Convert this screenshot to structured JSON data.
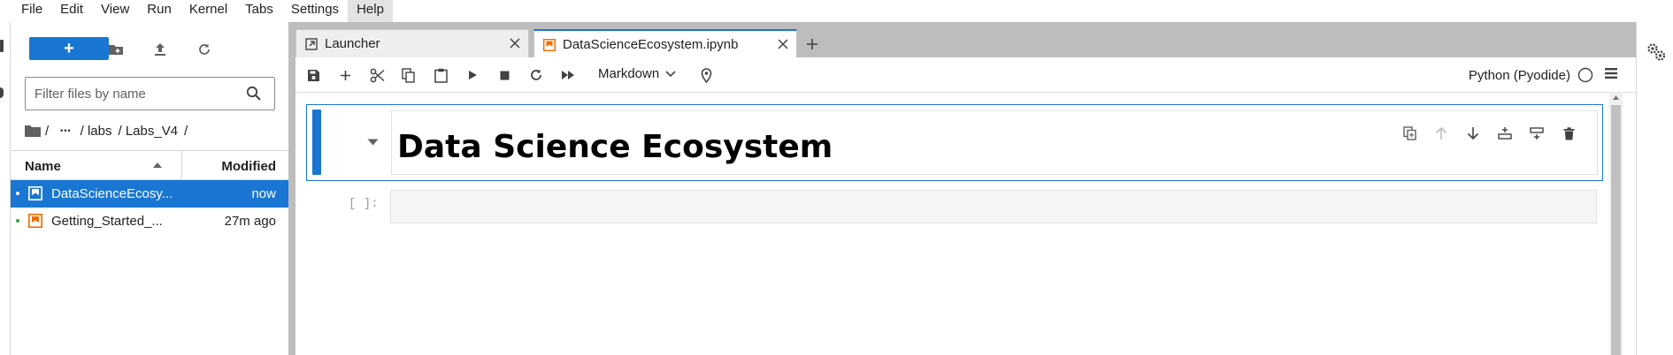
{
  "menubar": {
    "items": [
      "File",
      "Edit",
      "View",
      "Run",
      "Kernel",
      "Tabs",
      "Settings",
      "Help"
    ],
    "active": "Help"
  },
  "filebrowser": {
    "new_button": "+",
    "filter_placeholder": "Filter files by name",
    "breadcrumbs": [
      "/",
      "•••",
      "/ labs",
      "/ Labs_V4",
      "/"
    ],
    "columns": {
      "name": "Name",
      "modified": "Modified"
    },
    "files": [
      {
        "name": "DataScienceEcosystem.ipynb",
        "display": "DataScienceEcosy...",
        "modified": "now",
        "selected": true
      },
      {
        "name": "Getting_Started_with_Jupyter.ipynb",
        "display": "Getting_Started_...",
        "modified": "27m ago",
        "selected": false
      }
    ]
  },
  "tabs": [
    {
      "label": "Launcher",
      "icon": "launcher-icon"
    },
    {
      "label": "DataScienceEcosystem.ipynb",
      "icon": "notebook-icon"
    }
  ],
  "notebook": {
    "cell_type": "Markdown",
    "kernel": "Python (Pyodide)",
    "kernel_status": "idle",
    "cells": [
      {
        "type": "markdown",
        "rendered": "Data Science Ecosystem"
      },
      {
        "type": "code",
        "prompt": "[ ]:",
        "source": ""
      }
    ]
  },
  "colors": {
    "accent": "#1976d2",
    "notebook_icon": "#ef6c00",
    "panel_gray": "#bdbdbd"
  }
}
